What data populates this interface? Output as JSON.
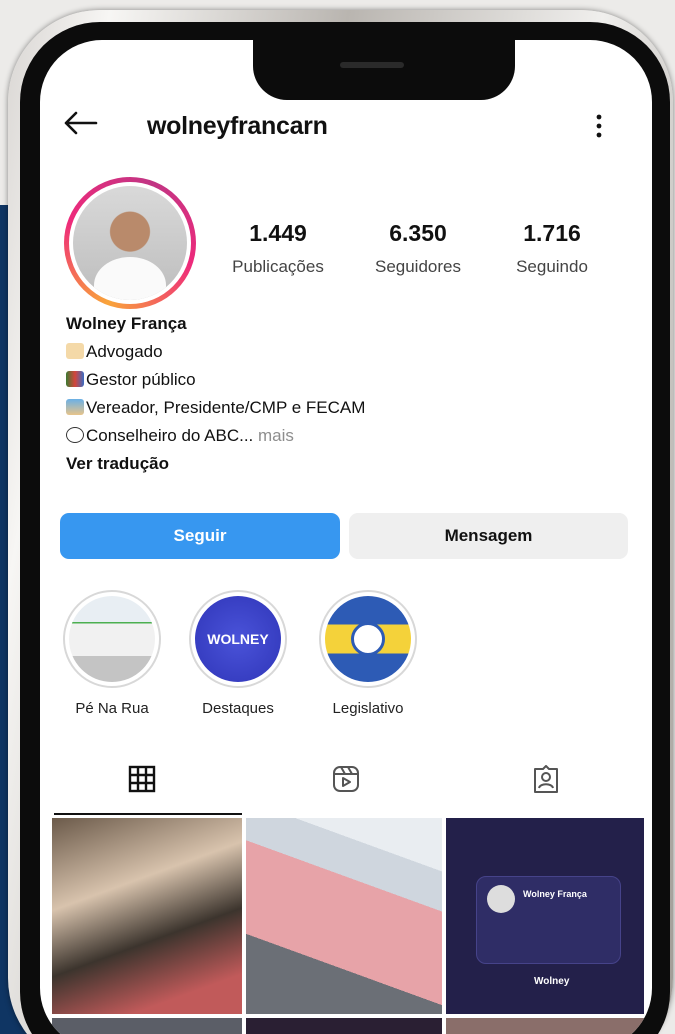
{
  "profile": {
    "username": "wolneyfrancarn",
    "stats": [
      {
        "value": "1.449",
        "label": "Publicações"
      },
      {
        "value": "6.350",
        "label": "Seguidores"
      },
      {
        "value": "1.716",
        "label": "Seguindo"
      }
    ],
    "bio": {
      "name": "Wolney França",
      "lines": [
        "Advogado",
        "Gestor público",
        "Vereador, Presidente/CMP e FECAM",
        "Conselheiro do ABC..."
      ],
      "more": "mais",
      "translate": "Ver tradução"
    }
  },
  "actions": {
    "follow": "Seguir",
    "message": "Mensagem"
  },
  "highlights": [
    {
      "label": "Pé Na Rua"
    },
    {
      "label": "Destaques",
      "image_text": "WOLNEY"
    },
    {
      "label": "Legislativo"
    }
  ],
  "icons": {
    "back": "arrow-left-icon",
    "more": "vertical-dots-icon",
    "tab_grid": "grid-icon",
    "tab_reels": "reels-icon",
    "tab_tagged": "tagged-icon"
  },
  "posts": {
    "post3_card_name": "Wolney França",
    "post3_caption": "Wolney"
  },
  "colors": {
    "follow_button": "#3797f0",
    "message_button": "#efefef",
    "background_blue": "#0f3563"
  }
}
